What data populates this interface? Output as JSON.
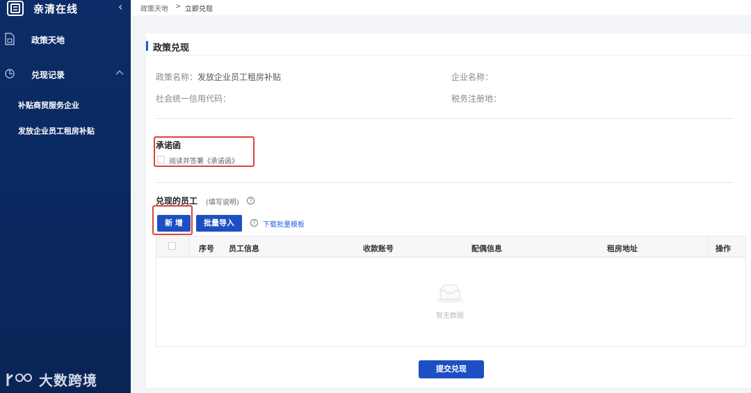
{
  "app": {
    "name": "亲清在线",
    "collapse_icon": "chevron-left-icon"
  },
  "sidebar": {
    "items": [
      {
        "label": "政策天地",
        "icon": "document-icon"
      },
      {
        "label": "兑现记录",
        "icon": "clock-icon",
        "expanded": true,
        "children": [
          {
            "label": "补贴商贸服务企业"
          },
          {
            "label": "发放企业员工租房补贴"
          }
        ]
      }
    ],
    "watermark": "大数跨境"
  },
  "breadcrumb": {
    "parent": "政策天地",
    "separator": ">",
    "current": "立即兑现"
  },
  "section": {
    "title": "政策兑现"
  },
  "info": {
    "policy_name_label": "政策名称：",
    "policy_name_value": "发放企业员工租房补贴",
    "company_name_label": "企业名称：",
    "credit_code_label": "社会统一信用代码：",
    "tax_place_label": "税务注册地："
  },
  "commitment": {
    "title": "承诺函",
    "checkbox_label": "阅读并签署《承诺函》",
    "checked": false
  },
  "employees": {
    "title": "兑现的员工",
    "hint": "(填写说明)",
    "add_button": "新 增",
    "import_button": "批量导入",
    "download_link": "下载批量模板",
    "table": {
      "columns": [
        "序号",
        "员工信息",
        "收款账号",
        "配偶信息",
        "租房地址",
        "操作"
      ],
      "rows": [],
      "empty_text": "暂无数据"
    }
  },
  "submit_button": "提交兑现",
  "colors": {
    "sidebar": "#0b2c66",
    "primary": "#1d4fc4",
    "highlight": "#d6453a"
  }
}
